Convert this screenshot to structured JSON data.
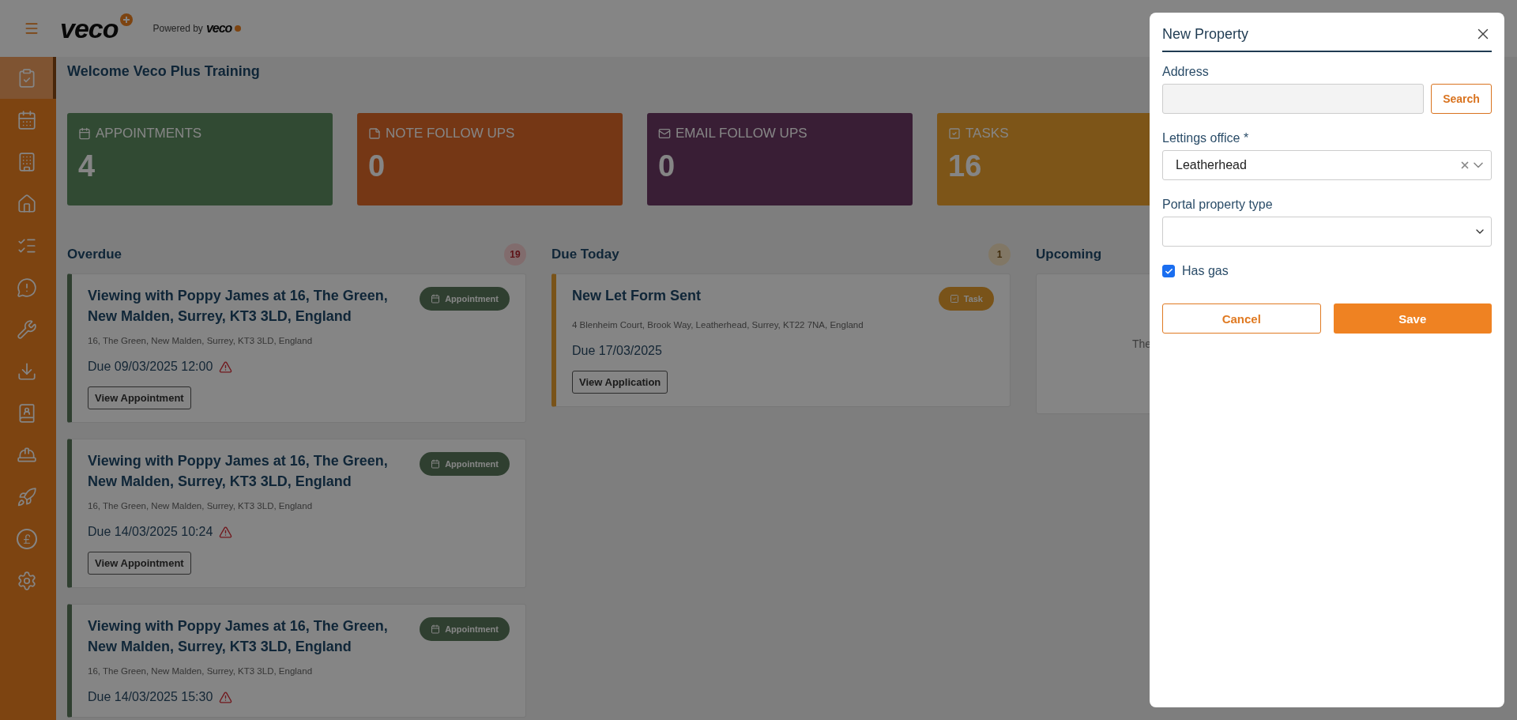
{
  "header": {
    "logo": "veco",
    "powered_by": "Powered by",
    "powered_logo": "veco"
  },
  "sidebar": {
    "items": [
      {
        "kind": "clipboard",
        "selected": true
      },
      {
        "kind": "calendar",
        "selected": false
      },
      {
        "kind": "building",
        "selected": false
      },
      {
        "kind": "house",
        "selected": false
      },
      {
        "kind": "checklist",
        "selected": false
      },
      {
        "kind": "message",
        "selected": false
      },
      {
        "kind": "tools",
        "selected": false
      },
      {
        "kind": "download",
        "selected": false
      },
      {
        "kind": "contacts",
        "selected": false
      },
      {
        "kind": "worker",
        "selected": false
      },
      {
        "kind": "rocket",
        "selected": false
      },
      {
        "kind": "pound",
        "selected": false
      },
      {
        "kind": "settings",
        "selected": false
      }
    ]
  },
  "welcome": "Welcome Veco Plus Training",
  "stats": [
    {
      "kind": "appointments",
      "label": "APPOINTMENTS",
      "value": "4"
    },
    {
      "kind": "notes",
      "label": "NOTE FOLLOW UPS",
      "value": "0"
    },
    {
      "kind": "emails",
      "label": "EMAIL FOLLOW UPS",
      "value": "0"
    },
    {
      "kind": "tasks",
      "label": "TASKS",
      "value": "16"
    }
  ],
  "columns": [
    {
      "kind": "overdue",
      "title": "Overdue",
      "count": "19",
      "cards": [
        {
          "kind": "appointment",
          "title": "Viewing with Poppy James at 16, The Green, New Malden, Surrey, KT3 3LD, England",
          "tag": "Appointment",
          "address": "16, The Green, New Malden, Surrey, KT3 3LD, England",
          "due": "Due 09/03/2025 12:00",
          "warning": true,
          "action": "View Appointment"
        },
        {
          "kind": "appointment",
          "title": "Viewing with Poppy James at 16, The Green, New Malden, Surrey, KT3 3LD, England",
          "tag": "Appointment",
          "address": "16, The Green, New Malden, Surrey, KT3 3LD, England",
          "due": "Due 14/03/2025 10:24",
          "warning": true,
          "action": "View Appointment"
        },
        {
          "kind": "appointment",
          "title": "Viewing with Poppy James at 16, The Green, New Malden, Surrey, KT3 3LD, England",
          "tag": "Appointment",
          "address": "16, The Green, New Malden, Surrey, KT3 3LD, England",
          "due": "Due 14/03/2025 15:30",
          "warning": true
        }
      ]
    },
    {
      "kind": "today",
      "title": "Due Today",
      "count": "1",
      "cards": [
        {
          "kind": "task",
          "title": "New Let Form Sent",
          "tag": "Task",
          "address": "4 Blenheim Court, Brook Way, Leatherhead, Surrey, KT22 7NA, England",
          "due": "Due 17/03/2025",
          "warning": false,
          "action": "View Application"
        }
      ]
    },
    {
      "title": "Upcoming",
      "empty_text": "The"
    }
  ],
  "dialog": {
    "title": "New Property",
    "address": {
      "label": "Address",
      "button": "Search"
    },
    "office": {
      "label": "Lettings office *",
      "value": "Leatherhead"
    },
    "property_type": {
      "label": "Portal property type"
    },
    "has_gas": {
      "label": "Has gas",
      "checked": true
    },
    "buttons": {
      "cancel": "Cancel",
      "save": "Save"
    }
  }
}
